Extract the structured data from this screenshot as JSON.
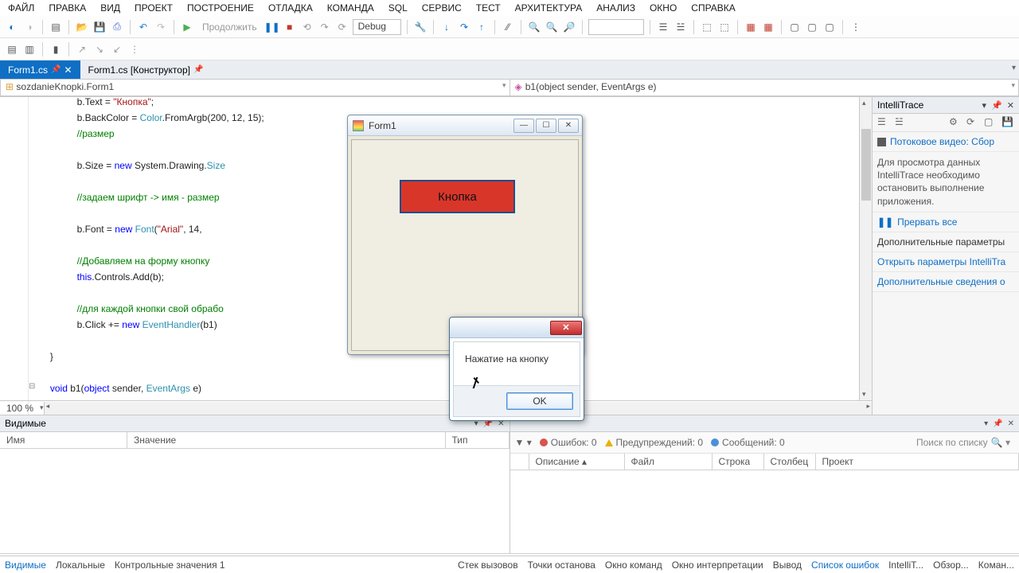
{
  "menu": [
    "ФАЙЛ",
    "ПРАВКА",
    "ВИД",
    "ПРОЕКТ",
    "ПОСТРОЕНИЕ",
    "ОТЛАДКА",
    "КОМАНДА",
    "SQL",
    "СЕРВИС",
    "ТЕСТ",
    "АРХИТЕКТУРА",
    "АНАЛИЗ",
    "ОКНО",
    "СПРАВКА"
  ],
  "toolbar": {
    "continue": "Продолжить",
    "config": "Debug"
  },
  "tabs": [
    {
      "label": "Form1.cs",
      "active": true,
      "pinned": true
    },
    {
      "label": "Form1.cs [Конструктор]",
      "active": false,
      "pinned": true
    }
  ],
  "nav": {
    "left": "sozdanieKnopki.Form1",
    "right": "b1(object sender, EventArgs e)"
  },
  "code": {
    "l1a": "b.Text = ",
    "l1b": "\"Кнопка\"",
    "l1c": ";",
    "l2a": "b.BackColor = ",
    "l2b": "Color",
    "l2c": ".FromArgb(200, 12, 15);",
    "l3": "//размер",
    "l4a": "b.Size = ",
    "l4b": "new",
    "l4c": " System.Drawing.",
    "l4d": "Size",
    "l5": "//задаем шрифт -> имя - размер",
    "l6a": "b.Font = ",
    "l6b": "new",
    "l6c": " ",
    "l6d": "Font",
    "l6e": "(",
    "l6f": "\"Arial\"",
    "l6g": ", 14,",
    "l7": "//Добавляем на форму кнопку",
    "l8a": "this",
    "l8b": ".Controls.Add(b);",
    "l9": "//для каждой кнопки свой обрабо",
    "l10a": "b.Click += ",
    "l10b": "new",
    "l10c": " ",
    "l10d": "EventHandler",
    "l10e": "(b1)",
    "l11": "}",
    "l12a": "void",
    "l12b": " b1(",
    "l12c": "object",
    "l12d": " sender, ",
    "l12e": "EventArgs",
    "l12f": " e)"
  },
  "zoom": "100 %",
  "intelli": {
    "title": "IntelliTrace",
    "video": "Потоковое видео: Сбор",
    "info": "Для просмотра данных IntelliTrace необходимо остановить выполнение приложения.",
    "break": "Прервать все",
    "extraTitle": "Дополнительные параметры",
    "link1": "Открыть параметры IntelliTra",
    "link2": "Дополнительные сведения о"
  },
  "watch": {
    "title": "Видимые",
    "cols": {
      "name": "Имя",
      "value": "Значение",
      "type": "Тип"
    }
  },
  "errlist": {
    "errors": "Ошибок: 0",
    "warnings": "Предупреждений: 0",
    "messages": "Сообщений: 0",
    "search": "Поиск по списку",
    "cols": {
      "desc": "Описание",
      "file": "Файл",
      "line": "Строка",
      "col": "Столбец",
      "proj": "Проект"
    }
  },
  "status": {
    "left": [
      "Видимые",
      "Локальные",
      "Контрольные значения 1"
    ],
    "right": [
      "Стек вызовов",
      "Точки останова",
      "Окно команд",
      "Окно интерпретации",
      "Вывод",
      "Список ошибок",
      "IntelliT...",
      "Обзор...",
      "Коман..."
    ]
  },
  "form1": {
    "title": "Form1",
    "button": "Кнопка"
  },
  "msgbox": {
    "text": "Нажатие на кнопку",
    "ok": "OK"
  }
}
